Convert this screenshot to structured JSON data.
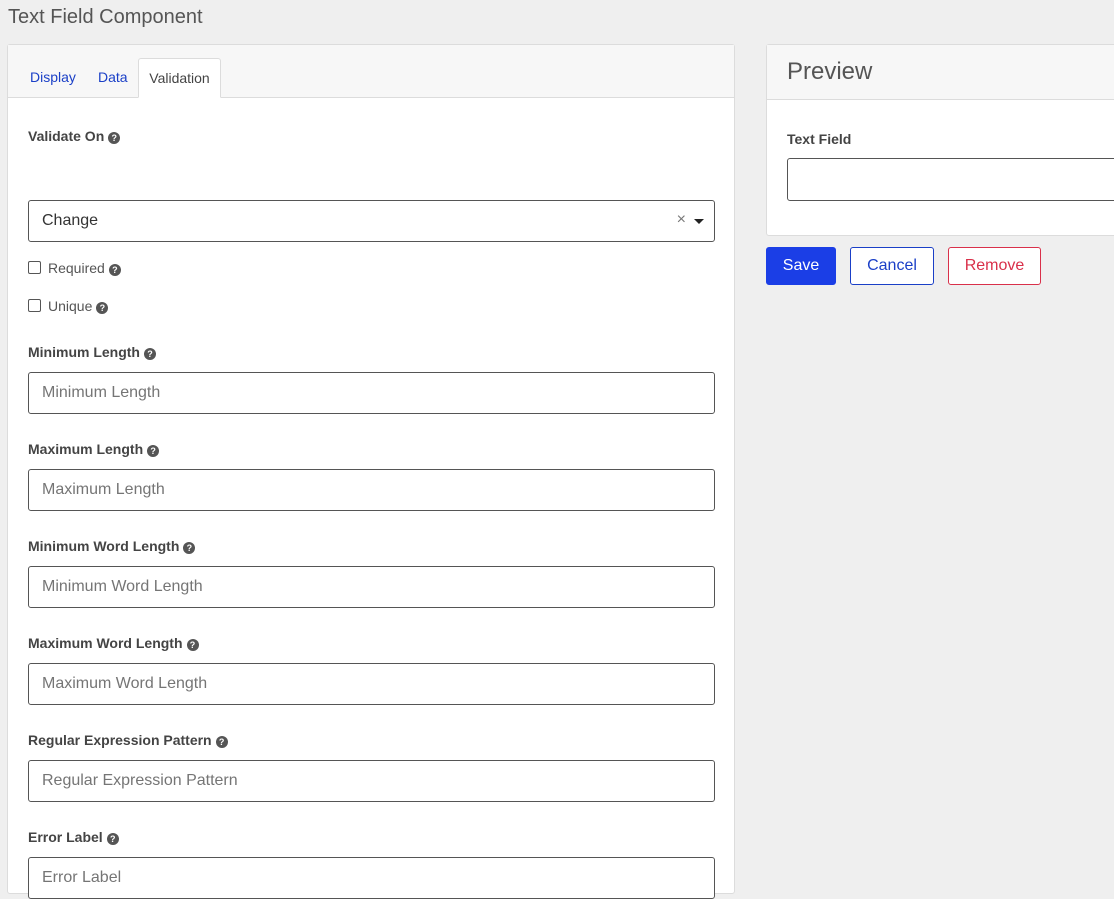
{
  "page": {
    "title": "Text Field Component"
  },
  "tabs": [
    {
      "label": "Display",
      "active": false
    },
    {
      "label": "Data",
      "active": false
    },
    {
      "label": "Validation",
      "active": true
    }
  ],
  "validation": {
    "validate_on": {
      "label": "Validate On",
      "value": "Change",
      "clear_glyph": "×"
    },
    "required": {
      "label": "Required",
      "checked": false
    },
    "unique": {
      "label": "Unique",
      "checked": false
    },
    "minimum_length": {
      "label": "Minimum Length",
      "placeholder": "Minimum Length",
      "value": ""
    },
    "maximum_length": {
      "label": "Maximum Length",
      "placeholder": "Maximum Length",
      "value": ""
    },
    "minimum_word_length": {
      "label": "Minimum Word Length",
      "placeholder": "Minimum Word Length",
      "value": ""
    },
    "maximum_word_length": {
      "label": "Maximum Word Length",
      "placeholder": "Maximum Word Length",
      "value": ""
    },
    "regex_pattern": {
      "label": "Regular Expression Pattern",
      "placeholder": "Regular Expression Pattern",
      "value": ""
    },
    "error_label": {
      "label": "Error Label",
      "placeholder": "Error Label",
      "value": ""
    }
  },
  "help_icon": {
    "glyph": "?",
    "icon": "question-circle-icon"
  },
  "preview": {
    "title": "Preview",
    "field_label": "Text Field",
    "field_value": ""
  },
  "actions": {
    "save": "Save",
    "cancel": "Cancel",
    "remove": "Remove"
  },
  "colors": {
    "primary": "#1b3ee6",
    "link": "#1a3fc7",
    "danger": "#d9304a",
    "background": "#efefef"
  }
}
